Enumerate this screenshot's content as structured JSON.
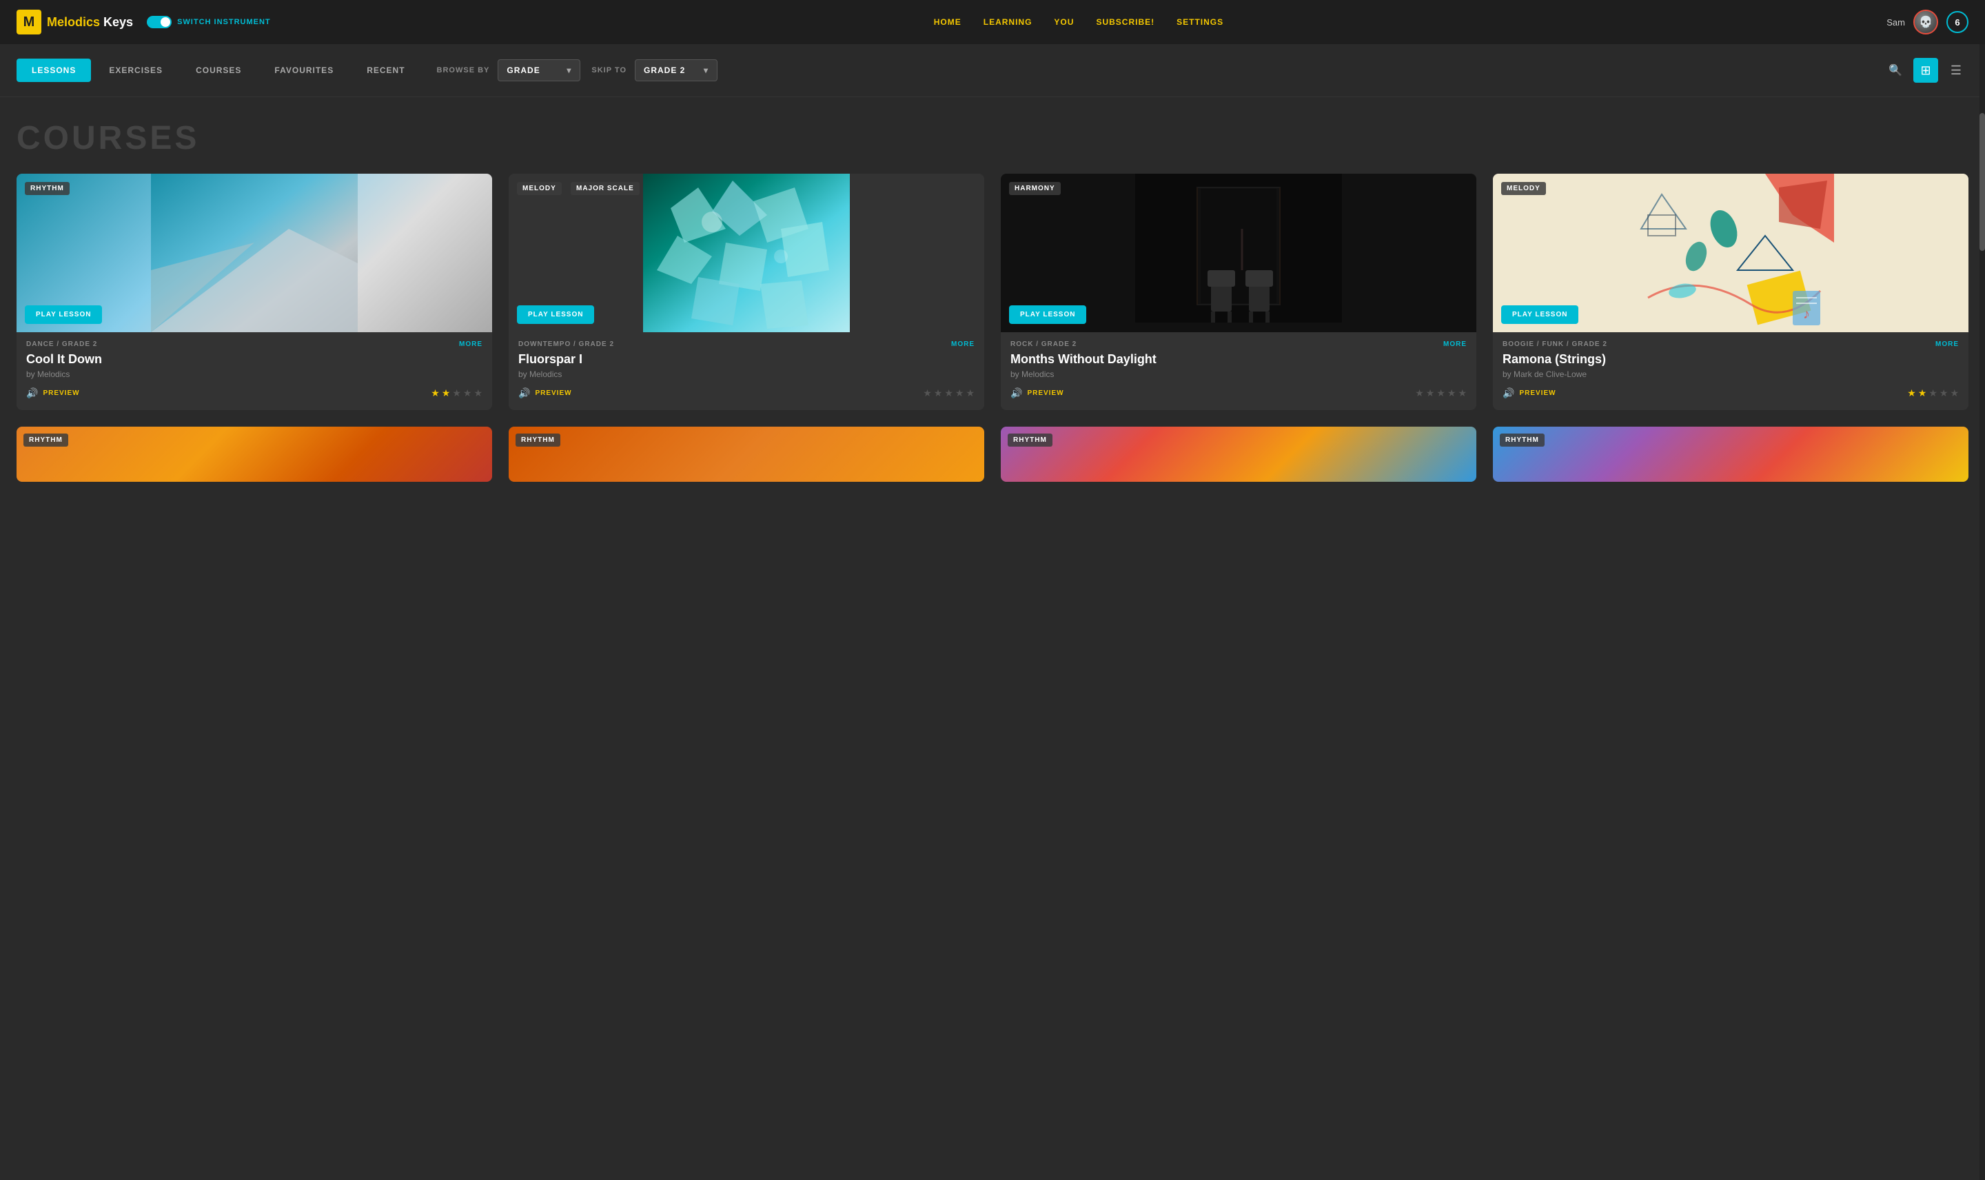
{
  "app": {
    "logo_letter": "M",
    "logo_melodics": "Melodics",
    "logo_keys": " Keys",
    "switch_label": "SWITCH INSTRUMENT"
  },
  "nav": {
    "items": [
      {
        "id": "home",
        "label": "HOME",
        "class": "home"
      },
      {
        "id": "learning",
        "label": "LEARNING",
        "class": "learning"
      },
      {
        "id": "you",
        "label": "YOU",
        "class": "you"
      },
      {
        "id": "subscribe",
        "label": "SUBSCRIBE!",
        "class": "subscribe"
      },
      {
        "id": "settings",
        "label": "SETTINGS",
        "class": "settings"
      }
    ]
  },
  "header_right": {
    "username": "Sam",
    "badge_count": "6"
  },
  "tabs": {
    "items": [
      {
        "id": "lessons",
        "label": "LESSONS",
        "active": true
      },
      {
        "id": "exercises",
        "label": "EXERCISES",
        "active": false
      },
      {
        "id": "courses",
        "label": "COURSES",
        "active": false
      },
      {
        "id": "favourites",
        "label": "FAVOURITES",
        "active": false
      },
      {
        "id": "recent",
        "label": "RECENT",
        "active": false
      }
    ],
    "browse_by_label": "BROWSE BY",
    "grade_dropdown": "GRADE",
    "skip_to_label": "SKIP TO",
    "grade2_dropdown": "GRADE 2"
  },
  "section": {
    "label": "COURSES"
  },
  "cards": [
    {
      "id": "cool-it-down",
      "tags": [
        "RHYTHM"
      ],
      "play_label": "PLAY LESSON",
      "genre": "DANCE / GRADE 2",
      "more_label": "MORE",
      "title": "Cool It Down",
      "author": "by Melodics",
      "preview_label": "PREVIEW",
      "stars": 2,
      "max_stars": 5,
      "image_type": "cool-it-down"
    },
    {
      "id": "fluorspar",
      "tags": [
        "MELODY",
        "MAJOR SCALE"
      ],
      "play_label": "PLAY LESSON",
      "genre": "DOWNTEMPO / GRADE 2",
      "more_label": "MORE",
      "title": "Fluorspar I",
      "author": "by Melodics",
      "preview_label": "PREVIEW",
      "stars": 0,
      "max_stars": 5,
      "image_type": "fluorspar"
    },
    {
      "id": "months-without-daylight",
      "tags": [
        "HARMONY"
      ],
      "play_label": "PLAY LESSON",
      "genre": "ROCK / GRADE 2",
      "more_label": "MORE",
      "title": "Months Without Daylight",
      "author": "by Melodics",
      "preview_label": "PREVIEW",
      "stars": 0,
      "max_stars": 5,
      "image_type": "months"
    },
    {
      "id": "ramona",
      "tags": [
        "MELODY"
      ],
      "play_label": "PLAY LESSON",
      "genre": "BOOGIE / FUNK / GRADE 2",
      "more_label": "MORE",
      "title": "Ramona (Strings)",
      "author": "by Mark de Clive-Lowe",
      "preview_label": "PREVIEW",
      "stars": 2,
      "max_stars": 5,
      "image_type": "ramona"
    }
  ],
  "bottom_cards": [
    {
      "id": "bc1",
      "tag": "RHYTHM"
    },
    {
      "id": "bc2",
      "tag": "RHYTHM"
    },
    {
      "id": "bc3",
      "tag": "RHYTHM"
    },
    {
      "id": "bc4",
      "tag": "RHYTHM"
    }
  ],
  "icons": {
    "search": "🔍",
    "grid": "⊞",
    "list": "≡",
    "speaker": "🔊",
    "chevron_down": "▾",
    "star_full": "★",
    "star_empty": "☆"
  }
}
